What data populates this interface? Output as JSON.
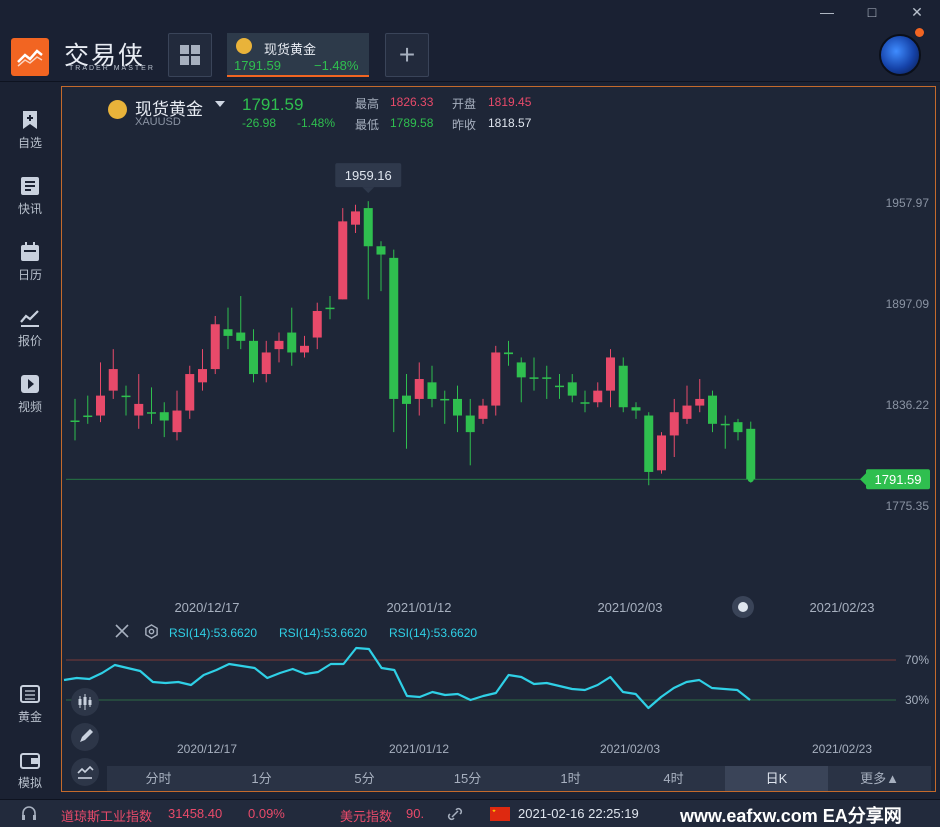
{
  "app": {
    "logo_text": "交易侠",
    "logo_sub": "TRADER MASTER",
    "tab": {
      "name": "现货黄金",
      "price": "1791.59",
      "change_pct": "−1.48%"
    },
    "add_label": "+",
    "window": {
      "minimize": "—",
      "maximize": "□",
      "close": "✕"
    }
  },
  "sidebar": {
    "items": [
      {
        "label": "自选",
        "icon": "bookmark-plus-icon"
      },
      {
        "label": "快讯",
        "icon": "news-list-icon"
      },
      {
        "label": "日历",
        "icon": "calendar-icon"
      },
      {
        "label": "报价",
        "icon": "trend-line-icon"
      },
      {
        "label": "视频",
        "icon": "video-play-icon"
      }
    ],
    "bottom_items": [
      {
        "label": "黄金",
        "icon": "gold-bar-icon"
      },
      {
        "label": "模拟",
        "icon": "wallet-icon"
      }
    ]
  },
  "quote": {
    "name": "现货黄金",
    "symbol": "XAUUSD",
    "price": "1791.59",
    "change": "-26.98",
    "change_pct": "-1.48%",
    "high_label": "最高",
    "high": "1826.33",
    "open_label": "开盘",
    "open": "1819.45",
    "low_label": "最低",
    "low": "1789.58",
    "prev_label": "昨收",
    "prev": "1818.57"
  },
  "chart_data": [
    {
      "type": "candlestick",
      "title": "现货黄金",
      "x_tick_labels": [
        "2020/12/17",
        "2021/01/12",
        "2021/02/03",
        "2021/02/23"
      ],
      "y_tick_labels": [
        "1957.97",
        "1897.09",
        "1836.22",
        "1775.35"
      ],
      "ylim": [
        1755.0,
        1990.0
      ],
      "last_price": "1791.59",
      "highlight_tag": "1959.16",
      "up_color": "#e84a6a",
      "down_color": "#2fbf4f",
      "candles": [
        {
          "o": 1827.0,
          "c": 1827.0,
          "h": 1840.0,
          "l": 1815.0
        },
        {
          "o": 1830.0,
          "c": 1830.0,
          "h": 1842.0,
          "l": 1825.0
        },
        {
          "o": 1830.0,
          "c": 1842.0,
          "h": 1862.0,
          "l": 1826.0
        },
        {
          "o": 1845.0,
          "c": 1858.0,
          "h": 1870.0,
          "l": 1840.0
        },
        {
          "o": 1842.0,
          "c": 1842.0,
          "h": 1848.0,
          "l": 1830.0
        },
        {
          "o": 1830.0,
          "c": 1837.0,
          "h": 1855.0,
          "l": 1822.0
        },
        {
          "o": 1832.0,
          "c": 1832.0,
          "h": 1847.0,
          "l": 1825.0
        },
        {
          "o": 1832.0,
          "c": 1827.0,
          "h": 1838.0,
          "l": 1817.0
        },
        {
          "o": 1820.0,
          "c": 1833.0,
          "h": 1845.0,
          "l": 1815.0
        },
        {
          "o": 1833.0,
          "c": 1855.0,
          "h": 1860.0,
          "l": 1828.0
        },
        {
          "o": 1850.0,
          "c": 1858.0,
          "h": 1870.0,
          "l": 1845.0
        },
        {
          "o": 1858.0,
          "c": 1885.0,
          "h": 1890.0,
          "l": 1855.0
        },
        {
          "o": 1882.0,
          "c": 1878.0,
          "h": 1895.0,
          "l": 1870.0
        },
        {
          "o": 1880.0,
          "c": 1875.0,
          "h": 1902.0,
          "l": 1870.0
        },
        {
          "o": 1875.0,
          "c": 1855.0,
          "h": 1882.0,
          "l": 1850.0
        },
        {
          "o": 1855.0,
          "c": 1868.0,
          "h": 1875.0,
          "l": 1850.0
        },
        {
          "o": 1870.0,
          "c": 1875.0,
          "h": 1880.0,
          "l": 1862.0
        },
        {
          "o": 1880.0,
          "c": 1868.0,
          "h": 1895.0,
          "l": 1860.0
        },
        {
          "o": 1868.0,
          "c": 1872.0,
          "h": 1878.0,
          "l": 1865.0
        },
        {
          "o": 1877.0,
          "c": 1893.0,
          "h": 1898.0,
          "l": 1870.0
        },
        {
          "o": 1895.0,
          "c": 1895.0,
          "h": 1902.0,
          "l": 1888.0
        },
        {
          "o": 1900.0,
          "c": 1947.0,
          "h": 1955.0,
          "l": 1900.0
        },
        {
          "o": 1945.0,
          "c": 1953.0,
          "h": 1957.0,
          "l": 1940.0
        },
        {
          "o": 1955.0,
          "c": 1932.0,
          "h": 1959.16,
          "l": 1900.0
        },
        {
          "o": 1932.0,
          "c": 1927.0,
          "h": 1935.0,
          "l": 1905.0
        },
        {
          "o": 1925.0,
          "c": 1840.0,
          "h": 1930.0,
          "l": 1820.0
        },
        {
          "o": 1842.0,
          "c": 1837.0,
          "h": 1855.0,
          "l": 1810.0
        },
        {
          "o": 1840.0,
          "c": 1852.0,
          "h": 1862.0,
          "l": 1830.0
        },
        {
          "o": 1850.0,
          "c": 1840.0,
          "h": 1860.0,
          "l": 1835.0
        },
        {
          "o": 1840.0,
          "c": 1840.0,
          "h": 1845.0,
          "l": 1825.0
        },
        {
          "o": 1840.0,
          "c": 1830.0,
          "h": 1848.0,
          "l": 1820.0
        },
        {
          "o": 1830.0,
          "c": 1820.0,
          "h": 1840.0,
          "l": 1800.0
        },
        {
          "o": 1828.0,
          "c": 1836.0,
          "h": 1840.0,
          "l": 1825.0
        },
        {
          "o": 1836.0,
          "c": 1868.0,
          "h": 1872.0,
          "l": 1830.0
        },
        {
          "o": 1868.0,
          "c": 1867.0,
          "h": 1875.0,
          "l": 1860.0
        },
        {
          "o": 1862.0,
          "c": 1853.0,
          "h": 1865.0,
          "l": 1838.0
        },
        {
          "o": 1853.0,
          "c": 1853.0,
          "h": 1865.0,
          "l": 1845.0
        },
        {
          "o": 1853.0,
          "c": 1853.0,
          "h": 1860.0,
          "l": 1840.0
        },
        {
          "o": 1848.0,
          "c": 1848.0,
          "h": 1855.0,
          "l": 1840.0
        },
        {
          "o": 1850.0,
          "c": 1842.0,
          "h": 1855.0,
          "l": 1838.0
        },
        {
          "o": 1838.0,
          "c": 1838.0,
          "h": 1845.0,
          "l": 1832.0
        },
        {
          "o": 1838.0,
          "c": 1845.0,
          "h": 1850.0,
          "l": 1835.0
        },
        {
          "o": 1845.0,
          "c": 1865.0,
          "h": 1870.0,
          "l": 1835.0
        },
        {
          "o": 1860.0,
          "c": 1835.0,
          "h": 1865.0,
          "l": 1832.0
        },
        {
          "o": 1835.0,
          "c": 1833.0,
          "h": 1838.0,
          "l": 1828.0
        },
        {
          "o": 1830.0,
          "c": 1796.0,
          "h": 1832.0,
          "l": 1788.0
        },
        {
          "o": 1797.0,
          "c": 1818.0,
          "h": 1820.0,
          "l": 1795.0
        },
        {
          "o": 1818.0,
          "c": 1832.0,
          "h": 1840.0,
          "l": 1805.0
        },
        {
          "o": 1828.0,
          "c": 1836.0,
          "h": 1848.0,
          "l": 1825.0
        },
        {
          "o": 1836.0,
          "c": 1840.0,
          "h": 1852.0,
          "l": 1832.0
        },
        {
          "o": 1842.0,
          "c": 1825.0,
          "h": 1845.0,
          "l": 1820.0
        },
        {
          "o": 1825.0,
          "c": 1825.0,
          "h": 1830.0,
          "l": 1810.0
        },
        {
          "o": 1826.0,
          "c": 1820.0,
          "h": 1828.0,
          "l": 1815.0
        },
        {
          "o": 1822.0,
          "c": 1791.59,
          "h": 1826.33,
          "l": 1789.58
        }
      ]
    },
    {
      "type": "line",
      "title": "RSI(14)",
      "legend": [
        "RSI(14):53.6620",
        "RSI(14):53.6620",
        "RSI(14):53.6620"
      ],
      "x_tick_labels": [
        "2020/12/17",
        "2021/01/12",
        "2021/02/03",
        "2021/02/23"
      ],
      "y_tick_labels": [
        "70%",
        "30%"
      ],
      "ylim": [
        10,
        90
      ],
      "series": [
        {
          "values": [
            50,
            52,
            51,
            57,
            65,
            62,
            59,
            48,
            47,
            48,
            45,
            55,
            60,
            66,
            64,
            62,
            52,
            57,
            61,
            56,
            58,
            66,
            66,
            82,
            81,
            62,
            60,
            34,
            33,
            38,
            35,
            36,
            30,
            34,
            37,
            55,
            53,
            46,
            47,
            44,
            41,
            40,
            45,
            53,
            38,
            36,
            22,
            33,
            42,
            48,
            50,
            42,
            41,
            40,
            30
          ]
        }
      ]
    }
  ],
  "toolbar_left": {
    "icons": [
      "candle-type-icon",
      "pencil-icon",
      "indicator-icon"
    ]
  },
  "timeframes": [
    "分时",
    "1分",
    "5分",
    "15分",
    "1时",
    "4时",
    "日K",
    "更多▲"
  ],
  "footer": {
    "index1_name": "道琼斯工业指数",
    "index1_value": "31458.40",
    "index1_pct": "0.09%",
    "index2_name": "美元指数",
    "index2_value": "90.",
    "datetime": "2021-02-16 22:25:19",
    "watermark": "www.eafxw.com EA分享网"
  }
}
